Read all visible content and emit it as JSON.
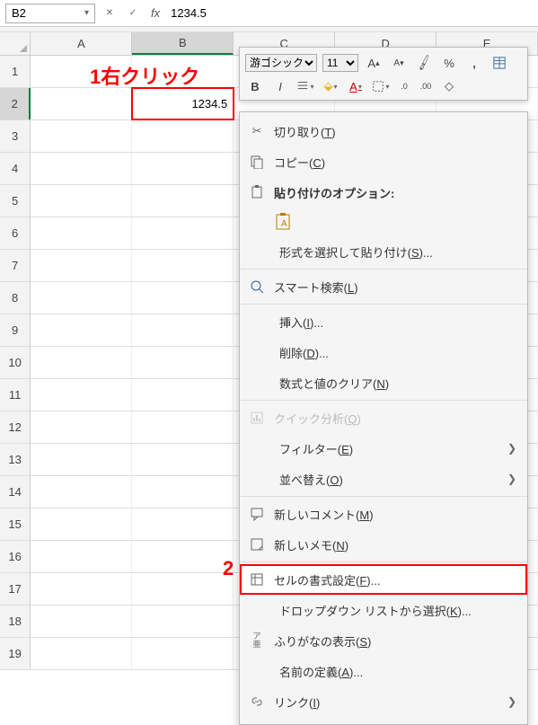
{
  "name_box": "B2",
  "formula_bar_value": "1234.5",
  "columns": [
    "A",
    "B",
    "C",
    "D",
    "E"
  ],
  "rows_count": 19,
  "selected_cell": {
    "row": 2,
    "col": "B",
    "value": "1234.5"
  },
  "annotations": {
    "a1": "1右クリック",
    "a2": "2"
  },
  "mini_toolbar": {
    "font_name": "游ゴシック",
    "font_size": "11",
    "increase_font_icon": "A",
    "decrease_font_icon": "A",
    "percent": "%",
    "comma": ",",
    "bold": "B",
    "italic": "I",
    "fill_letter": "A",
    "font_color_letter": "A",
    "decimal_inc": ".0",
    "decimal_dec": ".00"
  },
  "context_menu": {
    "cut": {
      "label_pre": "切り取り(",
      "u": "T",
      "label_post": ")"
    },
    "copy": {
      "label_pre": "コピー(",
      "u": "C",
      "label_post": ")"
    },
    "paste_header": "貼り付けのオプション:",
    "paste_special": {
      "label_pre": "形式を選択して貼り付け(",
      "u": "S",
      "label_post": ")..."
    },
    "smart_lookup": {
      "label_pre": "スマート検索(",
      "u": "L",
      "label_post": ")"
    },
    "insert": {
      "label_pre": "挿入(",
      "u": "I",
      "label_post": ")..."
    },
    "delete": {
      "label_pre": "削除(",
      "u": "D",
      "label_post": ")..."
    },
    "clear": {
      "label_pre": "数式と値のクリア(",
      "u": "N",
      "label_post": ")"
    },
    "quick_analysis": {
      "label_pre": "クイック分析(",
      "u": "Q",
      "label_post": ")"
    },
    "filter": {
      "label_pre": "フィルター(",
      "u": "E",
      "label_post": ")"
    },
    "sort": {
      "label_pre": "並べ替え(",
      "u": "O",
      "label_post": ")"
    },
    "new_comment": {
      "label_pre": "新しいコメント(",
      "u": "M",
      "label_post": ")"
    },
    "new_note": {
      "label_pre": "新しいメモ(",
      "u": "N",
      "label_post": ")"
    },
    "format_cells": {
      "label_pre": "セルの書式設定(",
      "u": "F",
      "label_post": ")..."
    },
    "dropdown_list": {
      "label_pre": "ドロップダウン リストから選択(",
      "u": "K",
      "label_post": ")..."
    },
    "furigana": {
      "label_pre": "ふりがなの表示(",
      "u": "S",
      "label_post": ")"
    },
    "define_name": {
      "label_pre": "名前の定義(",
      "u": "A",
      "label_post": ")..."
    },
    "link": {
      "label_pre": "リンク(",
      "u": "I",
      "label_post": ")"
    }
  }
}
